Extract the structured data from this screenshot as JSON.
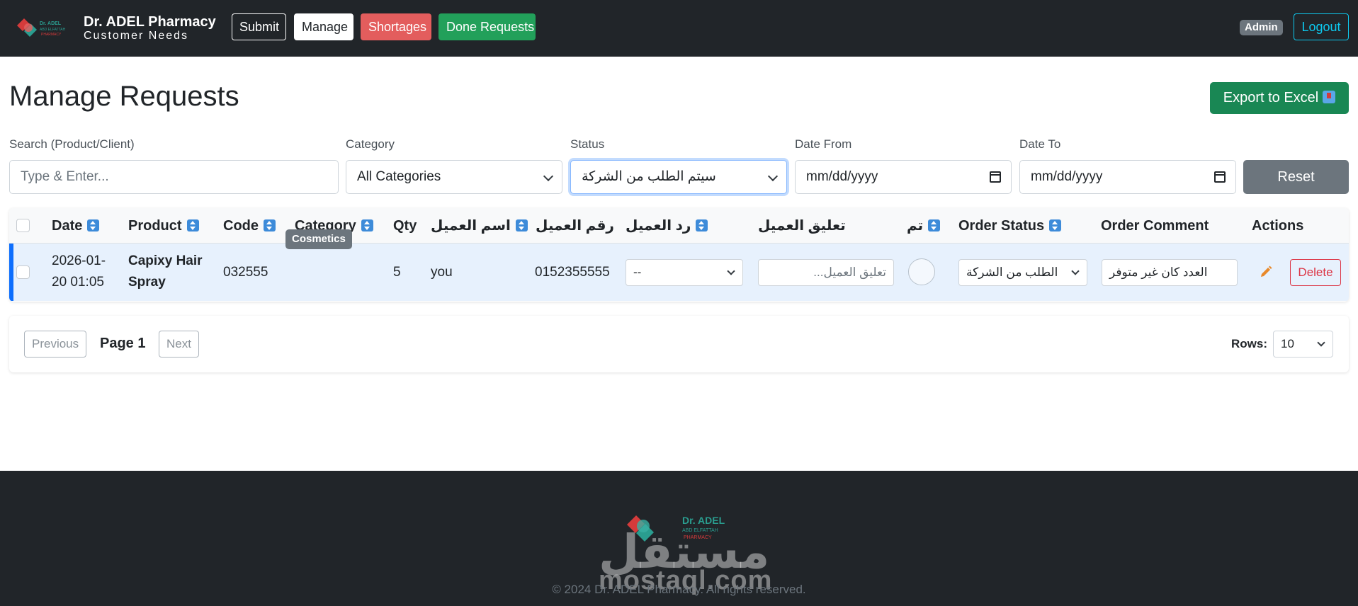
{
  "navbar": {
    "brand_title": "Dr. ADEL Pharmacy",
    "brand_subtitle": "Customer Needs",
    "logo_text": "Dr. ADEL",
    "logo_subtext": "ABD ELFATTAH",
    "logo_subtext2": "PHARMACY",
    "links": {
      "submit": "Submit",
      "manage": "Manage",
      "shortages": "Shortages",
      "done_requests": "Done Requests"
    },
    "user_badge": "Admin",
    "logout": "Logout"
  },
  "page": {
    "title": "Manage Requests",
    "export_label": "Export to Excel"
  },
  "filters": {
    "search_label": "Search (Product/Client)",
    "search_placeholder": "Type & Enter...",
    "category_label": "Category",
    "category_value": "All Categories",
    "status_label": "Status",
    "status_value": "سيتم الطلب من الشركة",
    "date_from_label": "Date From",
    "date_from_placeholder": "mm/dd/yyyy",
    "date_to_label": "Date To",
    "date_to_placeholder": "mm/dd/yyyy",
    "reset_label": "Reset"
  },
  "table": {
    "headers": {
      "date": "Date",
      "product": "Product",
      "code": "Code",
      "category": "Category",
      "qty": "Qty",
      "client_name": "اسم العميل",
      "client_phone": "رقم العميل",
      "client_reply": "رد العميل",
      "client_comment": "تعليق العميل",
      "done": "تم",
      "order_status": "Order Status",
      "order_comment": "Order Comment",
      "actions": "Actions"
    },
    "rows": [
      {
        "date_line1": "2026-01-",
        "date_line2": "20 01:05",
        "product_line1": "Capixy Hair",
        "product_line2": "Spray",
        "code": "032555",
        "category": "Cosmetics",
        "qty": "5",
        "client_name": "you",
        "client_phone": "0152355555",
        "client_reply": "--",
        "client_comment_placeholder": "تعليق العميل...",
        "order_status": "الطلب من الشركة",
        "order_comment": "العدد كان غير متوفر",
        "delete_label": "Delete"
      }
    ]
  },
  "pagination": {
    "previous": "Previous",
    "page_label": "Page 1",
    "next": "Next",
    "rows_label": "Rows:",
    "rows_value": "10"
  },
  "footer": {
    "watermark_ar": "مستقل",
    "watermark_en": "mostaql.com",
    "copyright": "© 2024 Dr. ADEL Pharmacy. All rights reserved."
  },
  "colors": {
    "navbar_bg": "#212529",
    "shortages": "#e35d5d",
    "done_requests": "#22a05a",
    "export": "#198754",
    "row_highlight": "#e7f1fd",
    "row_accent": "#0d6efd",
    "delete": "#dc3545",
    "logout": "#0dcaf0"
  }
}
